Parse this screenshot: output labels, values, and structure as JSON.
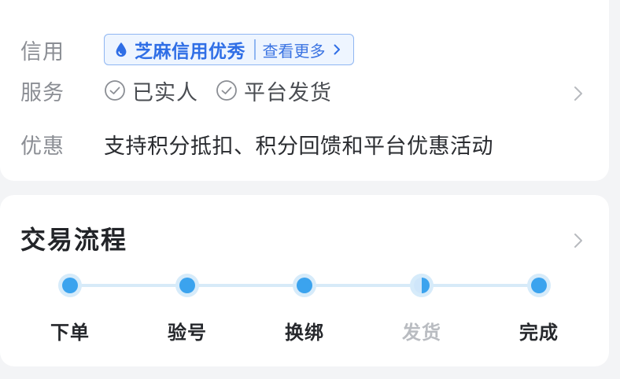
{
  "info_card": {
    "credit": {
      "label": "信用",
      "badge_text": "芝麻信用优秀",
      "more_text": "查看更多"
    },
    "service": {
      "label": "服务",
      "items": [
        "已实人",
        "平台发货"
      ]
    },
    "discount": {
      "label": "优惠",
      "text": "支持积分抵扣、积分回馈和平台优惠活动"
    }
  },
  "process": {
    "title": "交易流程",
    "steps": [
      {
        "label": "下单"
      },
      {
        "label": "验号"
      },
      {
        "label": "换绑"
      },
      {
        "label": "发货"
      },
      {
        "label": "完成"
      }
    ]
  },
  "colors": {
    "accent_blue": "#2f6ee6",
    "badge_bg": "#eef5ff",
    "step_blue": "#3ba3ee",
    "step_track": "#d7eaf8"
  },
  "icons": {
    "credit": "water-drop-icon",
    "service": "check-circle-icon",
    "more": "chevron-right-icon",
    "row_link": "chevron-right-icon"
  }
}
